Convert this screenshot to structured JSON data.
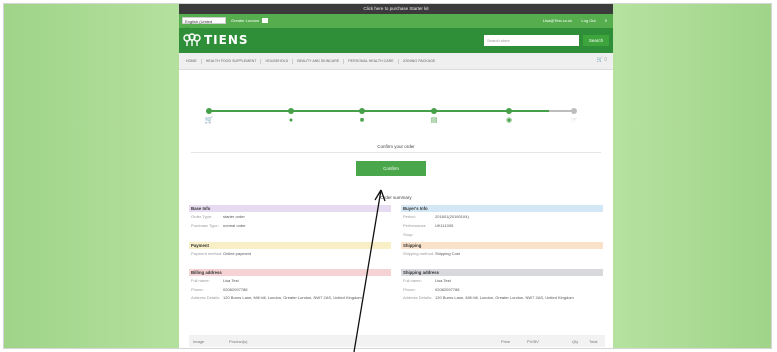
{
  "promo": {
    "text": "Click here to purchase Starter kit"
  },
  "topbar": {
    "language_select": "English (United Kingdom)",
    "region": "Greater London",
    "user_email": "Lisa@Test.co.uk",
    "logout": "Log Out",
    "cart_count": "0"
  },
  "brand": {
    "logo_text": "TIENS",
    "search_placeholder": "Search store",
    "search_button": "Search"
  },
  "nav": {
    "items": [
      "HOME",
      "HEALTH FOOD SUPPLEMENT",
      "HOUSEHOLD",
      "BEAUTY AND SKINCARE",
      "PERSONAL HEALTH CARE",
      "JOINING PACKAGE"
    ],
    "cart_label": "0"
  },
  "steps": {
    "icons": [
      "cart-icon",
      "location-pin-icon",
      "truck-icon",
      "card-icon",
      "check-circle-icon",
      "thumbs-up-icon"
    ],
    "completed": 5,
    "total": 6
  },
  "confirm": {
    "title": "Confirm your order",
    "submit_label": "Confirm"
  },
  "summary": {
    "title": "Order summary",
    "base_info": {
      "heading": "Base Info",
      "order_type_label": "Order Type:",
      "order_type_value": "starter order",
      "purchase_type_label": "Purchase Type:",
      "purchase_type_value": "normal order"
    },
    "buyer_info": {
      "heading": "Buyer's Info",
      "period_label": "Period:",
      "period_value": "201601(20160104)",
      "shop_label": "Performance Shop:",
      "shop_value": "UK111005"
    },
    "payment": {
      "heading": "Payment",
      "method_label": "Payment method:",
      "method_value": "Online payment"
    },
    "shipping": {
      "heading": "Shipping",
      "method_label": "Shipping method:",
      "method_value": "Shipping Cost"
    },
    "billing_address": {
      "heading": "Billing address",
      "name_label": "Full name:",
      "name_value": "Lisa Test",
      "phone_label": "Phone:",
      "phone_value": "02082097788",
      "address_label": "Address Details:",
      "address_value": "120 Burns Lane, Mill hill, London, Greater London, NW7 2AS, United Kingdom"
    },
    "shipping_address": {
      "heading": "Shipping address",
      "name_label": "Full name:",
      "name_value": "Lisa Test",
      "phone_label": "Phone:",
      "phone_value": "02082097788",
      "address_label": "Address Details:",
      "address_value": "120 Burns Lane, Mill hill, London, Greater London, NW7 2AS, United Kingdom"
    }
  },
  "table": {
    "headers": [
      "Image",
      "Product(s)",
      "Price",
      "PV/BV",
      "Qty",
      "Total"
    ]
  },
  "colors": {
    "primary_green": "#2e8f38",
    "accent_green": "#4aa64a",
    "background_green": "#a9db93"
  }
}
